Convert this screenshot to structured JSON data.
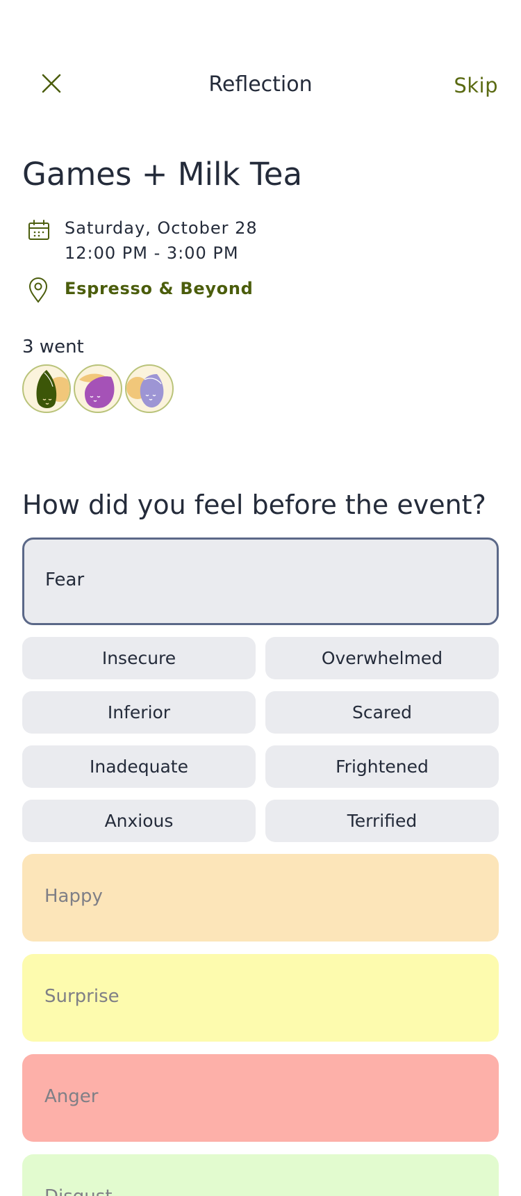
{
  "header": {
    "title": "Reflection",
    "skip_label": "Skip"
  },
  "event": {
    "title": "Games + Milk Tea",
    "date": "Saturday, October 28",
    "time": "12:00 PM - 3:00 PM",
    "location": "Espresso & Beyond",
    "went_count": "3 went"
  },
  "question": "How did you feel before the event?",
  "emotions": {
    "selected": "Fear",
    "fear_options": [
      "Insecure",
      "Overwhelmed",
      "Inferior",
      "Scared",
      "Inadequate",
      "Frightened",
      "Anxious",
      "Terrified"
    ],
    "others": [
      "Happy",
      "Surprise",
      "Anger",
      "Disgust"
    ]
  },
  "colors": {
    "accent": "#4b5d0c",
    "happy": "#fce5b9",
    "surprise": "#fdfbae",
    "anger": "#fdb0a9",
    "disgust": "#e2fbcf",
    "selected_border": "#5b6888"
  }
}
